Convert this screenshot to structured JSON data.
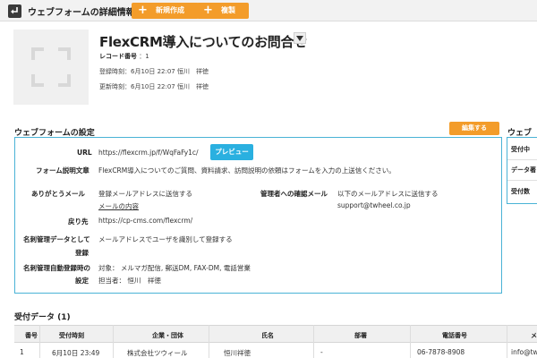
{
  "topbar": {
    "title": "ウェブフォームの詳細情報",
    "new_label": "新規作成",
    "copy_label": "複製"
  },
  "header": {
    "form_title": "FlexCRM導入についてのお問合せ",
    "record_label": "レコード番号",
    "record_value": "：1",
    "created": "登録時刻：6月10日 22:07  恒川　祥徳",
    "updated": "更新時刻：6月10日 22:07  恒川　祥徳"
  },
  "settings": {
    "section_title": "ウェブフォームの設定",
    "edit_label": "編集する",
    "url_label": "URL",
    "url_value": "https://flexcrm.jp/f/WqFaFy1c/",
    "preview_label": "プレビュー",
    "desc_label": "フォーム説明文章",
    "desc_value": "FlexCRM導入についてのご質問、資料請求、訪問説明の依頼はフォームを入力の上送信ください。",
    "thanks_label": "ありがとうメール",
    "thanks_value": "登録メールアドレスに送信する",
    "mail_content_link": "メールの内容",
    "admin_mail_label": "管理者への確認メール",
    "admin_mail_value": "以下のメールアドレスに送信する",
    "admin_mail_address": "support@twheel.co.jp",
    "return_label": "戻り先",
    "return_value": "https://cp-cms.com/flexcrm/",
    "card_label_1": "名刺管理データとして",
    "card_label_2": "登録",
    "card_value": "メールアドレスでユーザを識別して登録する",
    "auto_label_1": "名刺管理自動登録時の",
    "auto_label_2": "設定",
    "auto_target": "対象：  メルマガ配信, 郵送DM, FAX-DM, 電話営業",
    "auto_owner": "担当者：  恒川　祥徳"
  },
  "right_panel": {
    "title": "ウェブ",
    "rows": [
      "受付中",
      "データ著",
      "受付数"
    ]
  },
  "table": {
    "title": "受付データ (1)",
    "columns": [
      "番号",
      "受付時刻",
      "企業・団体",
      "氏名",
      "部署",
      "電話番号",
      "メ"
    ],
    "row": [
      "1",
      "6月10日 23:49",
      "株式会社ツウィール",
      "恒川祥徳",
      "-",
      "06-7878-8908",
      "info@tw"
    ]
  },
  "colors": {
    "accent_orange": "#f39c2a",
    "accent_blue": "#2ab0e0",
    "border_blue": "#4ab3d6"
  }
}
